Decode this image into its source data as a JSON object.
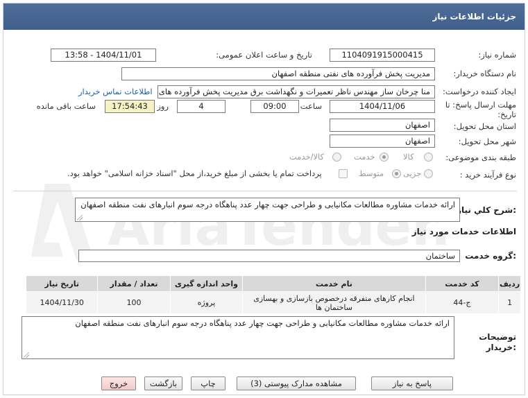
{
  "title": "جزئیات اطلاعات نیاز",
  "fields": {
    "need_number_label": "شماره نیاز:",
    "need_number": "1104091915000415",
    "announce_label": "تاریخ و ساعت اعلان عمومی:",
    "announce_value": "1404/11/01 - 13:58",
    "buyer_org_label": "نام دستگاه خریدار:",
    "buyer_org": "مدیریت پخش فرآورده های نفتی منطقه اصفهان",
    "requester_label": "ایجاد کننده درخواست:",
    "requester": "منا چرخان ساز مهندس ناظر تعمیرات و نگهداشت برق مدیریت پخش فرآورده های نفتی",
    "contact_link": "اطلاعات تماس خریدار",
    "deadline_label": "مهلت ارسال پاسخ: تا تاریخ:",
    "deadline_date": "1404/11/06",
    "time_label": "ساعت",
    "deadline_time": "09:00",
    "days": "4",
    "days_label": "روز و",
    "remaining": "17:54:43",
    "remaining_label": "ساعت باقی مانده",
    "province_label": "استان محل تحویل:",
    "province": "اصفهان",
    "city_label": "شهر محل تحویل:",
    "city": "اصفهان",
    "category_label": "طبقه بندی موضوعی:",
    "category_options": [
      "کالا",
      "خدمت",
      "کالا/خدمت"
    ],
    "process_label": "نوع فرآیند خرید :",
    "process_options": [
      "جزیی",
      "متوسط"
    ],
    "payment_note": "پرداخت تمام یا بخشی از مبلغ خرید،از محل \"اسناد خزانه اسلامی\" خواهد بود."
  },
  "description": {
    "label": "شرح کلي نیاز:",
    "text": "ارائه خدمات مشاوره مطالعات مکانیابی و طراحی جهت چهار عدد پناهگاه درجه سوم انبارهای نفت منطقه اصفهان"
  },
  "services": {
    "heading": "اطلاعات خدمات مورد نیاز",
    "group_label": "گروه خدمت:",
    "group_value": "ساختمان",
    "columns": [
      "ردیف",
      "کد خدمت",
      "نام خدمت",
      "واحد اندازه گیری",
      "تعداد / مقدار",
      "تاریخ نیاز"
    ],
    "rows": [
      [
        "1",
        "ج-44",
        "انجام کارهای متفرقه درخصوص بازسازی و بهسازی ساختمان ها",
        "پروژه",
        "100",
        "1404/11/30"
      ]
    ]
  },
  "buyer_notes": {
    "label": "توضیحات خریدار:",
    "text": "ارائه خدمات مشاوره مطالعات مکانیابی و طراحی جهت چهار عدد پناهگاه درجه سوم انبارهای نفت منطقه اصفهان"
  },
  "buttons": {
    "reply": "پاسخ به نیاز",
    "view_docs": "مشاهده مدارک پیوستی (3)",
    "print": "چاپ",
    "back": "بازگشت",
    "exit": "خروج"
  },
  "watermark_text": "AriaTender.net",
  "colors": {
    "titlebar": "#4a6a96",
    "link": "#1a5fb4",
    "remaining_bg": "#f7f2c4",
    "exit_bg": "#f4c9c9"
  }
}
